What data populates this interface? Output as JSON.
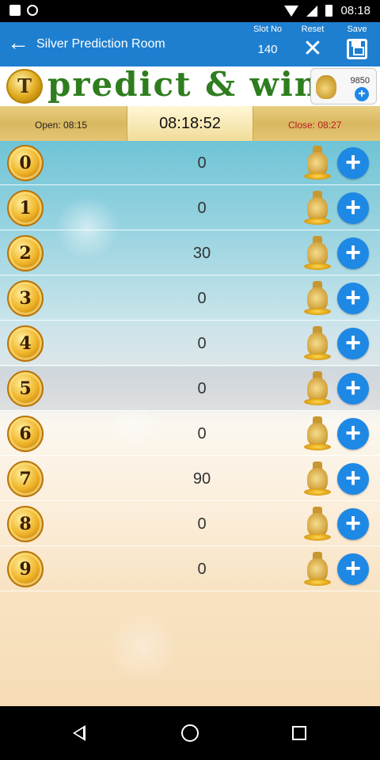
{
  "status_bar": {
    "time": "08:18",
    "icons": [
      "image-icon",
      "whatsapp-icon",
      "wifi-icon",
      "signal-icon",
      "battery-icon"
    ]
  },
  "app_bar": {
    "title": "Silver Prediction Room",
    "slot_label": "Slot No",
    "slot_value": "140",
    "reset_label": "Reset",
    "save_label": "Save",
    "color": "#1e7fd0"
  },
  "banner": {
    "logo_letter": "T",
    "text": "predict & win",
    "wallet_balance": "9850"
  },
  "timer": {
    "open": "Open: 08:15",
    "clock": "08:18:52",
    "close": "Close: 08:27"
  },
  "rows": [
    {
      "number": "0",
      "value": "0"
    },
    {
      "number": "1",
      "value": "0"
    },
    {
      "number": "2",
      "value": "30"
    },
    {
      "number": "3",
      "value": "0"
    },
    {
      "number": "4",
      "value": "0"
    },
    {
      "number": "5",
      "value": "0"
    },
    {
      "number": "6",
      "value": "0"
    },
    {
      "number": "7",
      "value": "90"
    },
    {
      "number": "8",
      "value": "0"
    },
    {
      "number": "9",
      "value": "0"
    }
  ],
  "colors": {
    "accent_blue": "#1e88e5",
    "gold": "#d9b860",
    "close_red": "#b71c1c"
  }
}
